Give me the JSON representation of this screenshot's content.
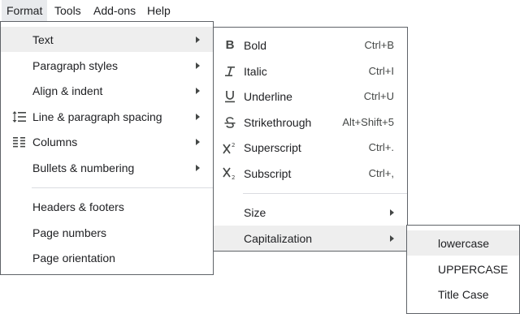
{
  "menubar": {
    "items": [
      {
        "label": "Format"
      },
      {
        "label": "Tools"
      },
      {
        "label": "Add-ons"
      },
      {
        "label": "Help"
      }
    ]
  },
  "format_menu": {
    "items": [
      {
        "label": "Text",
        "icon": "none",
        "submenu": true
      },
      {
        "label": "Paragraph styles",
        "icon": "none",
        "submenu": true
      },
      {
        "label": "Align & indent",
        "icon": "none",
        "submenu": true
      },
      {
        "label": "Line & paragraph spacing",
        "icon": "line-spacing-icon",
        "submenu": true
      },
      {
        "label": "Columns",
        "icon": "columns-icon",
        "submenu": true
      },
      {
        "label": "Bullets & numbering",
        "icon": "none",
        "submenu": true
      },
      {
        "label": "Headers & footers",
        "icon": "none",
        "submenu": false
      },
      {
        "label": "Page numbers",
        "icon": "none",
        "submenu": false
      },
      {
        "label": "Page orientation",
        "icon": "none",
        "submenu": false
      }
    ]
  },
  "text_menu": {
    "items": [
      {
        "label": "Bold",
        "shortcut": "Ctrl+B",
        "icon": "bold-icon"
      },
      {
        "label": "Italic",
        "shortcut": "Ctrl+I",
        "icon": "italic-icon"
      },
      {
        "label": "Underline",
        "shortcut": "Ctrl+U",
        "icon": "underline-icon"
      },
      {
        "label": "Strikethrough",
        "shortcut": "Alt+Shift+5",
        "icon": "strikethrough-icon"
      },
      {
        "label": "Superscript",
        "shortcut": "Ctrl+.",
        "icon": "superscript-icon"
      },
      {
        "label": "Subscript",
        "shortcut": "Ctrl+,",
        "icon": "subscript-icon"
      },
      {
        "label": "Size",
        "icon": "none",
        "submenu": true
      },
      {
        "label": "Capitalization",
        "icon": "none",
        "submenu": true
      }
    ]
  },
  "capitalization_menu": {
    "items": [
      {
        "label": "lowercase"
      },
      {
        "label": "UPPERCASE"
      },
      {
        "label": "Title Case"
      }
    ]
  },
  "colors": {
    "highlight": "#eeeeee",
    "menubar_active": "#e8eaed",
    "border": "#5f6368",
    "separator": "#dadce0",
    "text": "#202124"
  }
}
